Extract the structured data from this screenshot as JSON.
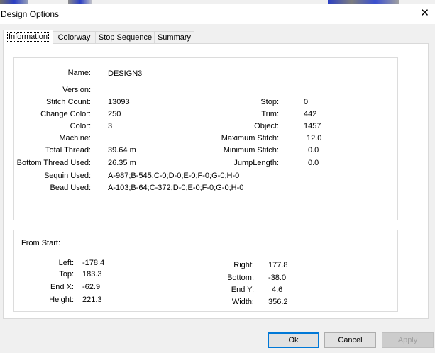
{
  "window": {
    "title": "Design Options",
    "close_glyph": "✕"
  },
  "tabs": [
    {
      "label": "Information",
      "active": true
    },
    {
      "label": "Colorway",
      "active": false
    },
    {
      "label": "Stop Sequence",
      "active": false
    },
    {
      "label": "Summary",
      "active": false
    }
  ],
  "info": {
    "name": {
      "label": "Name:",
      "value": "DESIGN3"
    },
    "version": {
      "label": "Version:",
      "value": ""
    },
    "stitch_count": {
      "label": "Stitch Count:",
      "value": "13093"
    },
    "change_color": {
      "label": "Change Color:",
      "value": "250"
    },
    "color": {
      "label": "Color:",
      "value": "3"
    },
    "machine": {
      "label": "Machine:",
      "value": ""
    },
    "total_thread": {
      "label": "Total Thread:",
      "value": "39.64 m"
    },
    "bottom_thread": {
      "label": "Bottom Thread Used:",
      "value": "26.35 m"
    },
    "sequin": {
      "label": "Sequin Used:",
      "value": "A-987;B-545;C-0;D-0;E-0;F-0;G-0;H-0"
    },
    "bead": {
      "label": "Bead Used:",
      "value": "A-103;B-64;C-372;D-0;E-0;F-0;G-0;H-0"
    },
    "stop": {
      "label": "Stop:",
      "value": "0"
    },
    "trim": {
      "label": "Trim:",
      "value": "442"
    },
    "object": {
      "label": "Object:",
      "value": "1457"
    },
    "max_stitch": {
      "label": "Maximum Stitch:",
      "value": "12.0"
    },
    "min_stitch": {
      "label": "Minimum Stitch:",
      "value": "0.0"
    },
    "jump_length": {
      "label": "JumpLength:",
      "value": "0.0"
    }
  },
  "from_start": {
    "heading": "From Start:",
    "left": {
      "label": "Left:",
      "value": "-178.4"
    },
    "top": {
      "label": "Top:",
      "value": "183.3"
    },
    "end_x": {
      "label": "End X:",
      "value": "-62.9"
    },
    "height": {
      "label": "Height:",
      "value": "221.3"
    },
    "right": {
      "label": "Right:",
      "value": "177.8"
    },
    "bottom": {
      "label": "Bottom:",
      "value": "-38.0"
    },
    "end_y": {
      "label": "End Y:",
      "value": "4.6"
    },
    "width": {
      "label": "Width:",
      "value": "356.2"
    }
  },
  "buttons": {
    "ok": "Ok",
    "cancel": "Cancel",
    "apply": "Apply"
  },
  "colors": {
    "accent": "#0078d7",
    "background_art": "#2b3fc4"
  }
}
